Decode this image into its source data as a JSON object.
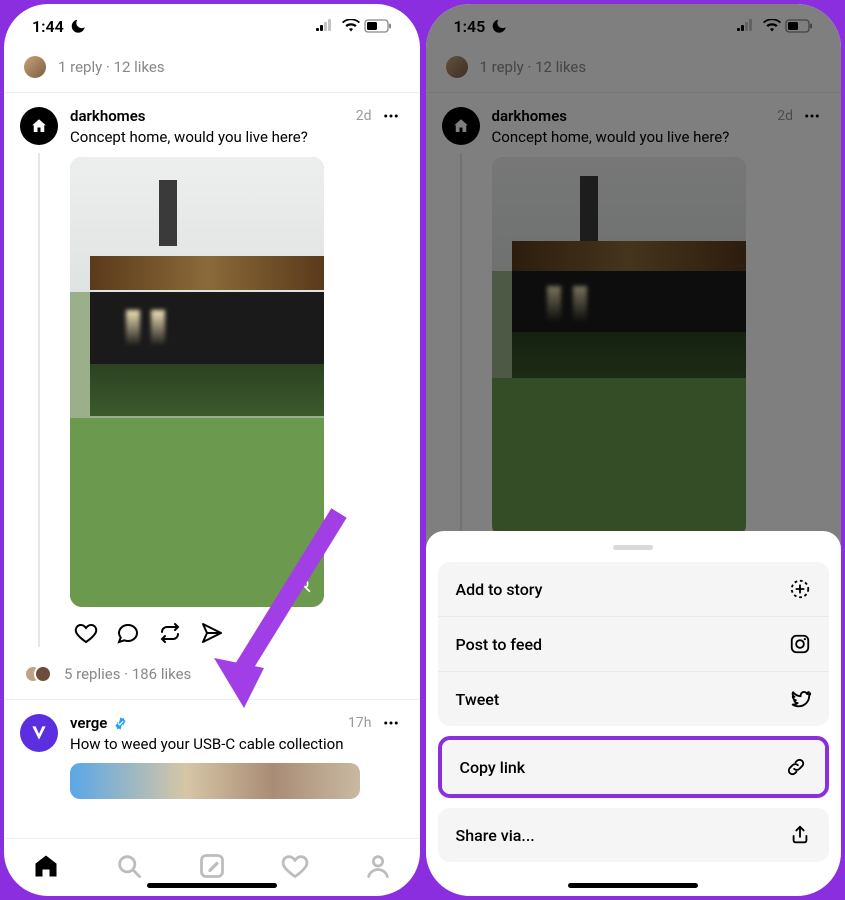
{
  "left": {
    "status": {
      "time": "1:44"
    },
    "top_stats": "1 reply · 12 likes",
    "post1": {
      "username": "darkhomes",
      "time": "2d",
      "text": "Concept home, would you live here?",
      "stats": "5 replies · 186 likes"
    },
    "post2": {
      "username": "verge",
      "time": "17h",
      "text": "How to weed your USB-C cable collection"
    }
  },
  "right": {
    "status": {
      "time": "1:45"
    },
    "top_stats": "1 reply · 12 likes",
    "post1": {
      "username": "darkhomes",
      "time": "2d",
      "text": "Concept home, would you live here?"
    },
    "sheet": {
      "add_story": "Add to story",
      "post_feed": "Post to feed",
      "tweet": "Tweet",
      "copy_link": "Copy link",
      "share_via": "Share via..."
    }
  }
}
